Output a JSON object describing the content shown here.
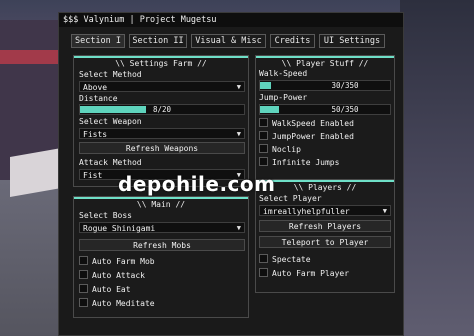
{
  "window": {
    "title": "$$$ Valynium | Project Mugetsu"
  },
  "tabs": [
    "Section I",
    "Section II",
    "Visual & Misc",
    "Credits",
    "UI Settings"
  ],
  "settings_farm": {
    "header": "\\\\ Settings Farm //",
    "select_method_label": "Select Method",
    "select_method_value": "Above",
    "distance_label": "Distance",
    "distance_value": "8/20",
    "distance_fraction": 0.4,
    "select_weapon_label": "Select Weapon",
    "select_weapon_value": "Fists",
    "refresh_weapons": "Refresh Weapons",
    "attack_method_label": "Attack Method",
    "attack_method_value": "Fist"
  },
  "main": {
    "header": "\\\\ Main //",
    "select_boss_label": "Select Boss",
    "select_boss_value": "Rogue Shinigami",
    "refresh_mobs": "Refresh Mobs",
    "toggles": [
      "Auto Farm Mob",
      "Auto Attack",
      "Auto Eat",
      "Auto Meditate"
    ]
  },
  "player_stuff": {
    "header": "\\\\ Player Stuff //",
    "walkspeed_label": "Walk-Speed",
    "walkspeed_value": "30/350",
    "walkspeed_fraction": 0.086,
    "jumppower_label": "Jump-Power",
    "jumppower_value": "50/350",
    "jumppower_fraction": 0.143,
    "toggles": [
      "WalkSpeed Enabled",
      "JumpPower Enabled",
      "Noclip",
      "Infinite Jumps"
    ]
  },
  "players": {
    "header": "\\\\ Players //",
    "select_player_label": "Select Player",
    "select_player_value": "imreallyhelpfuller",
    "refresh_players": "Refresh Players",
    "teleport_to_player": "Teleport to Player",
    "toggles": [
      "Spectate",
      "Auto Farm Player"
    ]
  },
  "watermark": "depohile.com",
  "colors": {
    "accent": "#6fe0c8",
    "slider_fill": "#5fd4bd",
    "window_bg": "#1a1a1a"
  }
}
